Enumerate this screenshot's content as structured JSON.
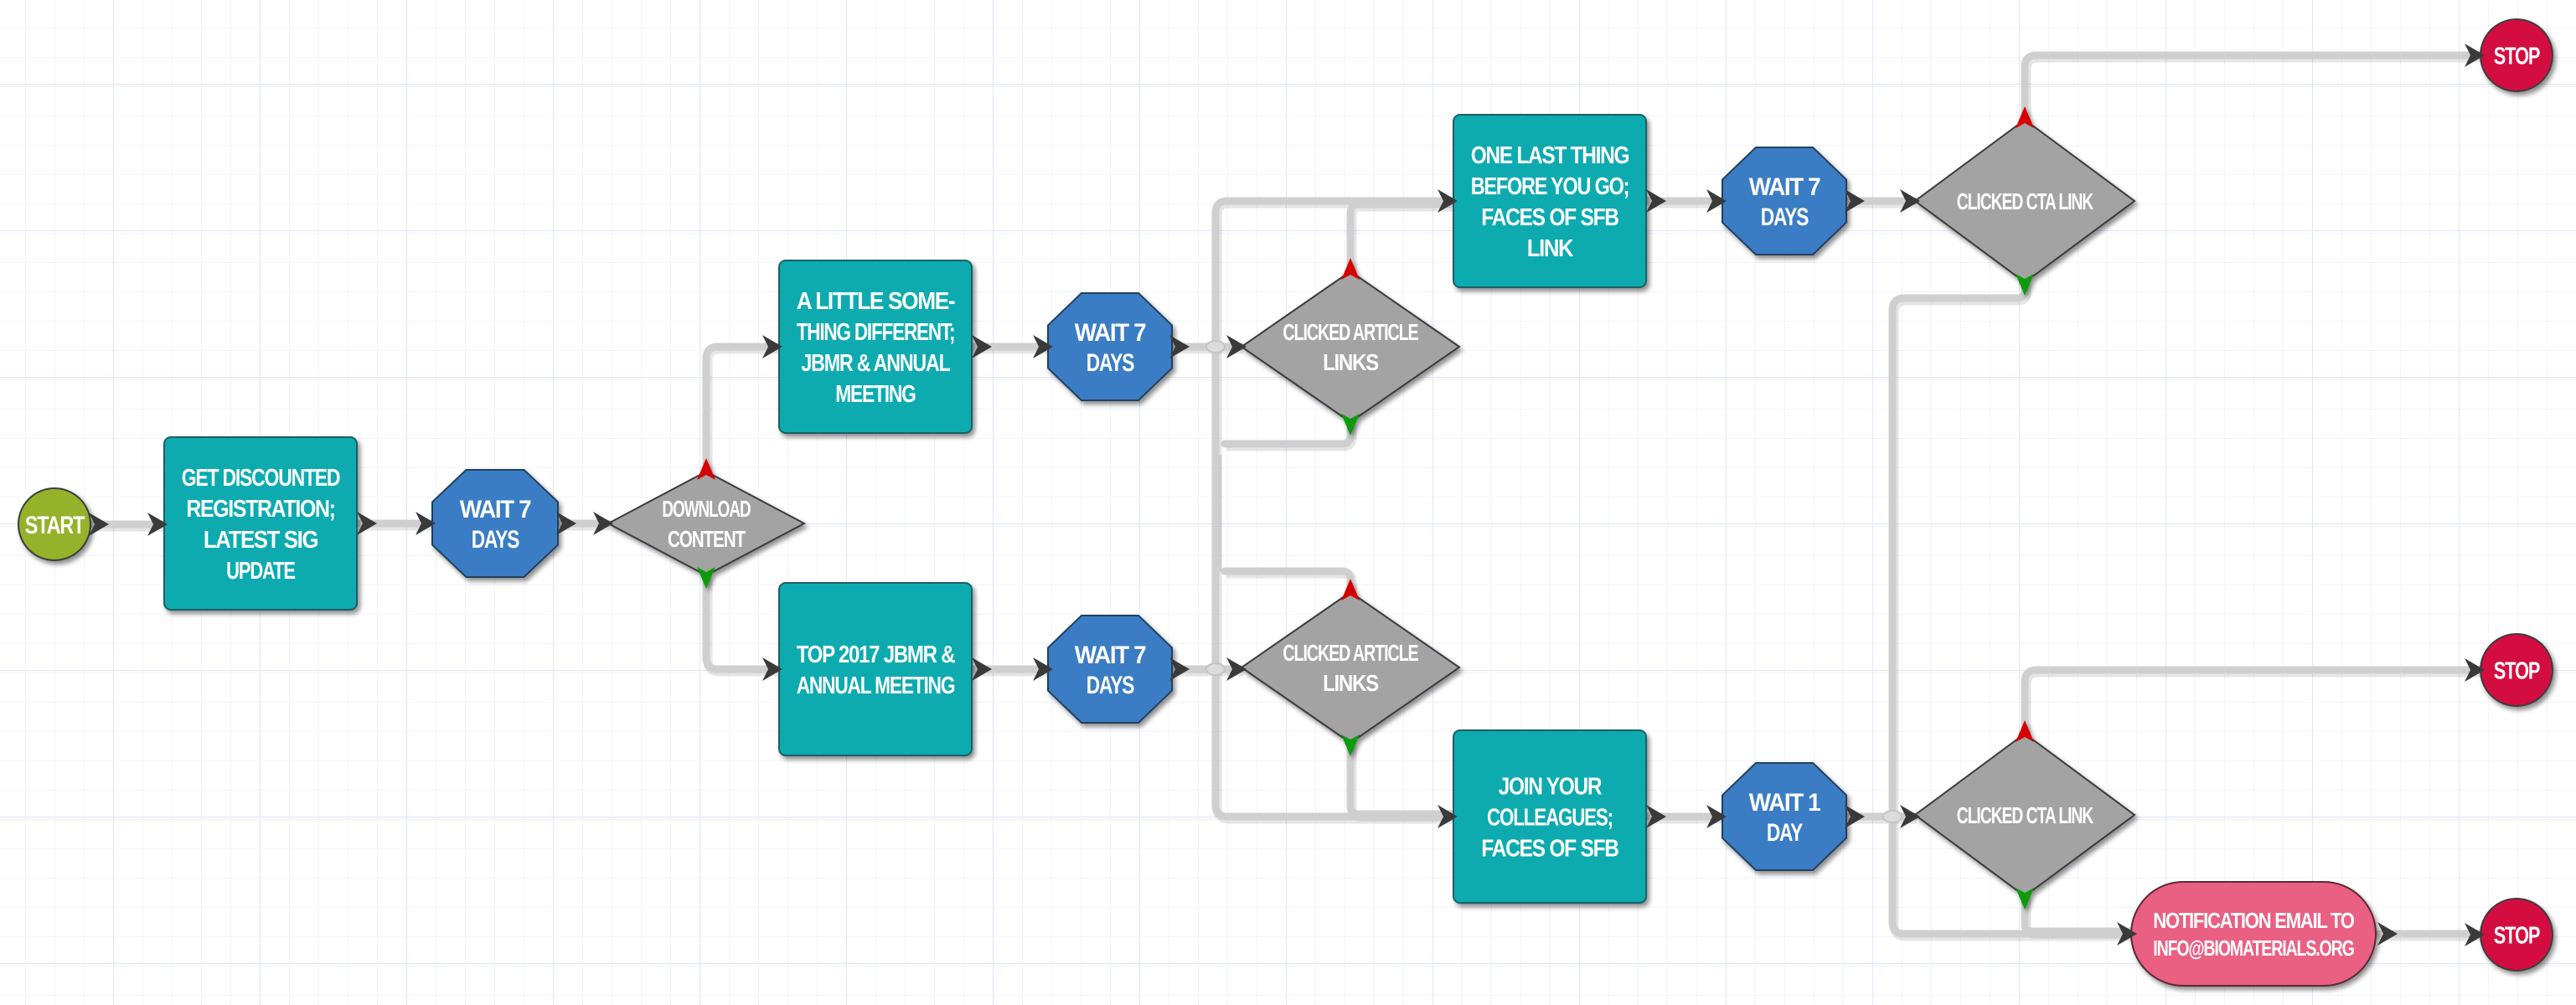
{
  "diagram": {
    "type": "marketing-email-workflow",
    "colors": {
      "start": "#95b22b",
      "email": "#0aabb0",
      "wait": "#3b7dc4",
      "decision": "#a3a3a3",
      "stop": "#d4073f",
      "notification": "#ea6082",
      "yes_marker": "#d40000",
      "no_marker": "#0a9a0a",
      "connector": "#cfcfcf",
      "grid_minor": "#eef0fb",
      "grid_major": "#e1e5f7"
    },
    "nodes": [
      {
        "id": "start",
        "kind": "start",
        "lines": [
          "START"
        ]
      },
      {
        "id": "email1",
        "kind": "email",
        "lines": [
          "GET DISCOUNTED",
          "REGISTRATION;",
          "LATEST SIG",
          "UPDATE"
        ]
      },
      {
        "id": "wait1",
        "kind": "wait",
        "lines": [
          "WAIT 7",
          "DAYS"
        ]
      },
      {
        "id": "dec1",
        "kind": "decision",
        "lines": [
          "DOWNLOAD",
          "CONTENT"
        ]
      },
      {
        "id": "email2",
        "kind": "email",
        "lines": [
          "A LITTLE SOME-",
          "THING DIFFERENT;",
          "JBMR & ANNUAL",
          "MEETING"
        ]
      },
      {
        "id": "email3",
        "kind": "email",
        "lines": [
          "TOP 2017 JBMR &",
          "ANNUAL MEETING"
        ]
      },
      {
        "id": "wait2",
        "kind": "wait",
        "lines": [
          "WAIT 7",
          "DAYS"
        ]
      },
      {
        "id": "wait3",
        "kind": "wait",
        "lines": [
          "WAIT 7",
          "DAYS"
        ]
      },
      {
        "id": "dec2",
        "kind": "decision",
        "lines": [
          "CLICKED ARTICLE",
          "LINKS"
        ]
      },
      {
        "id": "dec3",
        "kind": "decision",
        "lines": [
          "CLICKED ARTICLE",
          "LINKS"
        ]
      },
      {
        "id": "email4",
        "kind": "email",
        "lines": [
          "ONE LAST THING",
          "BEFORE YOU GO;",
          "FACES OF SFB",
          "LINK"
        ]
      },
      {
        "id": "email5",
        "kind": "email",
        "lines": [
          "JOIN YOUR",
          "COLLEAGUES;",
          "FACES OF SFB"
        ]
      },
      {
        "id": "wait4",
        "kind": "wait",
        "lines": [
          "WAIT 7",
          "DAYS"
        ]
      },
      {
        "id": "wait5",
        "kind": "wait",
        "lines": [
          "WAIT 1",
          "DAY"
        ]
      },
      {
        "id": "dec4",
        "kind": "decision",
        "lines": [
          "CLICKED CTA LINK"
        ]
      },
      {
        "id": "dec5",
        "kind": "decision",
        "lines": [
          "CLICKED CTA LINK"
        ]
      },
      {
        "id": "stop1",
        "kind": "stop",
        "lines": [
          "STOP"
        ]
      },
      {
        "id": "stop2",
        "kind": "stop",
        "lines": [
          "STOP"
        ]
      },
      {
        "id": "notify",
        "kind": "notification",
        "lines": [
          "NOTIFICATION EMAIL TO",
          "INFO@BIOMATERIALS.ORG"
        ]
      },
      {
        "id": "stop3",
        "kind": "stop",
        "lines": [
          "STOP"
        ]
      }
    ],
    "edges": [
      {
        "from": "start",
        "to": "email1"
      },
      {
        "from": "email1",
        "to": "wait1"
      },
      {
        "from": "wait1",
        "to": "dec1"
      },
      {
        "from": "dec1",
        "to": "email2",
        "branch": "yes"
      },
      {
        "from": "dec1",
        "to": "email3",
        "branch": "no"
      },
      {
        "from": "email2",
        "to": "wait2"
      },
      {
        "from": "email3",
        "to": "wait3"
      },
      {
        "from": "wait2",
        "to": "dec2"
      },
      {
        "from": "wait3",
        "to": "dec3"
      },
      {
        "from": "dec2",
        "to": "email4",
        "branch": "yes"
      },
      {
        "from": "dec2",
        "to": "email5",
        "branch": "no"
      },
      {
        "from": "dec3",
        "to": "email4",
        "branch": "yes"
      },
      {
        "from": "dec3",
        "to": "email5",
        "branch": "no"
      },
      {
        "from": "email4",
        "to": "wait4"
      },
      {
        "from": "email5",
        "to": "wait5"
      },
      {
        "from": "wait4",
        "to": "dec4"
      },
      {
        "from": "wait5",
        "to": "dec5"
      },
      {
        "from": "dec4",
        "to": "stop1",
        "branch": "yes"
      },
      {
        "from": "dec4",
        "to": "notify",
        "branch": "no"
      },
      {
        "from": "dec5",
        "to": "stop2",
        "branch": "yes"
      },
      {
        "from": "dec5",
        "to": "notify",
        "branch": "no"
      },
      {
        "from": "notify",
        "to": "stop3"
      }
    ]
  }
}
